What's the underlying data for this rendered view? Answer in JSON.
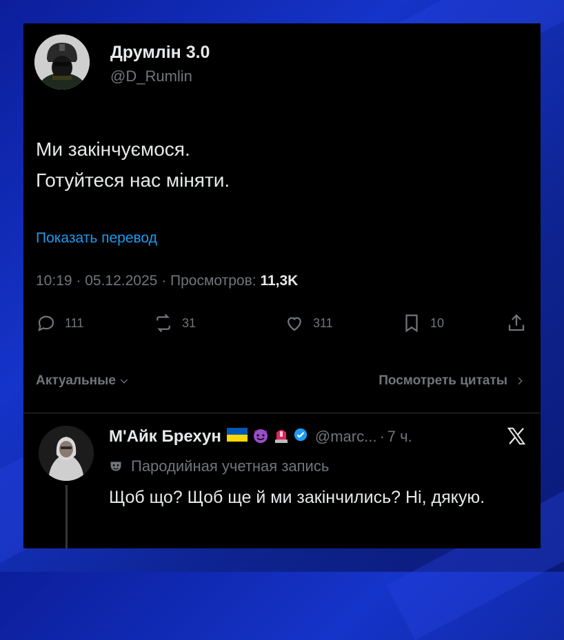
{
  "author": {
    "name": "Друмлін 3.0",
    "handle": "@D_Rumlin"
  },
  "tweet": {
    "lines": [
      "Ми закінчуємося.",
      "Готуйтеся нас міняти."
    ],
    "translate_link": "Показать перевод",
    "time": "10:19",
    "date": "05.12.2025",
    "views_label": "Просмотров:",
    "views_value": "11,3K"
  },
  "actions": {
    "replies": "111",
    "reposts": "31",
    "likes": "311",
    "bookmarks": "10"
  },
  "sort": {
    "relevant_label": "Актуальные",
    "view_quotes_label": "Посмотреть цитаты"
  },
  "reply": {
    "name": "М'Айк Брехун",
    "handle": "@marc...",
    "time": "7 ч.",
    "parody_label": "Пародийная учетная запись",
    "text": "Щоб що? Щоб ще й ми закінчились? Ні, дякую."
  },
  "colors": {
    "accent": "#1d9bf0",
    "muted": "#71767b",
    "text": "#e7e9ea",
    "background": "#000000",
    "frame": "#1534c9"
  },
  "icons": [
    "reply-icon",
    "repost-icon",
    "like-icon",
    "bookmark-icon",
    "share-icon",
    "chevron-down-icon",
    "chevron-right-icon",
    "verified-badge-icon",
    "x-logo-icon",
    "parody-mask-icon"
  ]
}
